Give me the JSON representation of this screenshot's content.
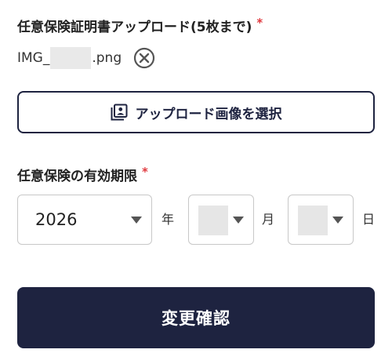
{
  "insurance_upload": {
    "label": "任意保険証明書アップロード(5枚まで)",
    "required_mark": "*",
    "file": {
      "name_prefix": "IMG_",
      "name_suffix": ".png",
      "remove_icon": "close-circle-icon"
    },
    "upload_button": {
      "label": "アップロード画像を選択",
      "icon": "image-upload-icon"
    }
  },
  "expiry": {
    "label": "任意保険の有効期限",
    "required_mark": "*",
    "year": {
      "value": "2026",
      "unit": "年"
    },
    "month": {
      "value": "",
      "unit": "月"
    },
    "day": {
      "value": "",
      "unit": "日"
    }
  },
  "submit_button": {
    "label": "変更確認"
  },
  "colors": {
    "primary": "#1e2340",
    "required": "#e0393e",
    "border": "#c8c8c8",
    "mask": "#e6e6e6"
  }
}
